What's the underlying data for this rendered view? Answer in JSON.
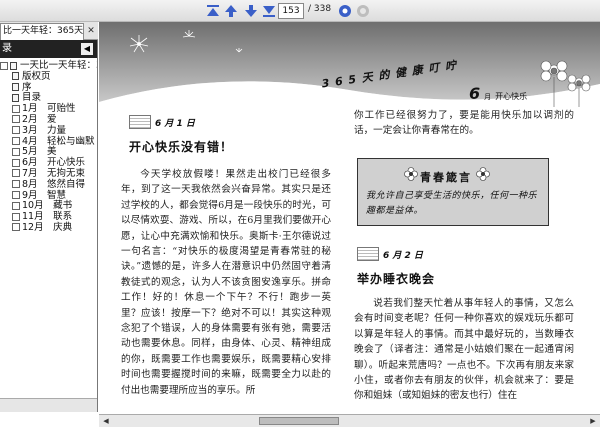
{
  "toolbar": {
    "current_page": "153",
    "total_pages": "/ 338",
    "icons": [
      "first-page-icon",
      "prev-page-icon",
      "next-page-icon",
      "last-page-icon",
      "go-icon",
      "stop-icon"
    ],
    "accent": "#3a5fc8"
  },
  "tab": {
    "title": "比一天年轻：365天...",
    "close": "✕"
  },
  "sidebar": {
    "header": "录",
    "collapse": "◀",
    "root": "一天比一天年轻：365",
    "items": [
      {
        "label": "版权页"
      },
      {
        "label": "序"
      },
      {
        "label": "目录"
      },
      {
        "label": "1月　可贻性"
      },
      {
        "label": "2月　爱"
      },
      {
        "label": "3月　力量"
      },
      {
        "label": "4月　轻松与幽默"
      },
      {
        "label": "5月　美"
      },
      {
        "label": "6月　开心快乐"
      },
      {
        "label": "7月　无拘无束"
      },
      {
        "label": "8月　悠然自得"
      },
      {
        "label": "9月　智慧"
      },
      {
        "label": "10月　藏书"
      },
      {
        "label": "11月　联系"
      },
      {
        "label": "12月　庆典"
      }
    ]
  },
  "banner": {
    "title": "3 6 5 天 的 健 康 叮 咛",
    "month": "6",
    "month_suffix": "月",
    "month_theme": "开心快乐"
  },
  "page": {
    "date1": "6 月 1 日",
    "heading1": "开心快乐没有错！",
    "left_text": "今天学校放假喽！果然走出校门已经很多年，到了这一天我依然会兴奋异常。其实只是还过学校的人，都会觉得6月是一段快乐的时光，可以尽情欢耍、游戏、所以，在6月里我们要做开心愿，让心中充满欢愉和快乐。奥斯卡·王尔德说过一句名言：“对快乐的极度渴望是青春常驻的秘诀。”遗憾的是，许多人在潜意识中仍然固守着清教徒式的观念，认为人不该贪图安逸享乐。拼命工作！好的！休息一个下午？不行！跑步一英里？应该！按摩一下？绝对不可以！其实这种观念犯了个错误，人的身体需要有张有弛，需要活动也需要休息。同样，由身体、心灵、精神组成的你，既需要工作也需要娱乐，既需要精心安排时间也需要握搅时间的来嘛，既需要全力以赴的付出也需要理所应当的享乐。所",
    "right_text1": "你工作已经很努力了，要是能用快乐加以调剂的话，一定会让你青春常在的。",
    "quote_title": "青春箴言",
    "quote_body": "我允许自己享受生活的快乐，任何一种乐趣都是益体。",
    "date2": "6 月 2 日",
    "heading2": "举办睡衣晚会",
    "right_text2": "说若我们整天忙着从事年轻人的事情，又怎么会有时间变老呢？任何一种你喜欢的娱戏玩乐都可以算是年轻人的事情。而其中最好玩的，当数睡衣晚会了（译者注：通常是小姑娘们聚在一起通宵闲聊）。听起来荒唐吗？一点也不。下次再有朋友来家小住，或者你去有朋友的伙伴，机会就来了：要是你和姐妹（或知姐妹的密友也行）住在"
  },
  "scrollbars": {
    "left": "◀",
    "right": "▶"
  }
}
